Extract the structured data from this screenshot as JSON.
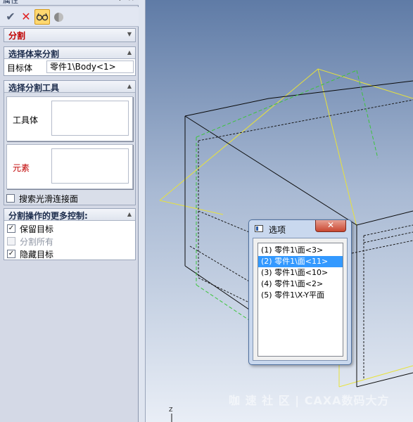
{
  "panel": {
    "title": "属性",
    "pin_glyph": "+",
    "close_glyph": "×",
    "toolbar": {
      "ok_icon": "checkmark-icon",
      "cancel_icon": "x-icon",
      "preview_icon": "glasses-icon",
      "help_icon": "half-circle-icon"
    },
    "split_section": {
      "label": "分割"
    },
    "target_section": {
      "label": "选择体来分割",
      "field_label": "目标体",
      "field_value": "零件1\\Body<1>"
    },
    "tools_section": {
      "label": "选择分割工具",
      "tool_body_label": "工具体",
      "element_label": "元素",
      "smooth_label": "搜索光滑连接面"
    },
    "more_section": {
      "label": "分割操作的更多控制:",
      "keep_target": "保留目标",
      "split_all": "分割所有",
      "hide_target": "隐藏目标"
    },
    "colors": {
      "accent_red": "#c00000"
    }
  },
  "viewport": {
    "watermark": "咖 速 社 区 | CAXA数码大方",
    "axis_label": "Z"
  },
  "dialog": {
    "title": "选项",
    "close_glyph": "✕",
    "options": [
      "(1) 零件1\\面<3>",
      "(2) 零件1\\面<11>",
      "(3) 零件1\\面<10>",
      "(4) 零件1\\面<2>",
      "(5) 零件1\\X-Y平面"
    ],
    "selected_index": 1
  }
}
